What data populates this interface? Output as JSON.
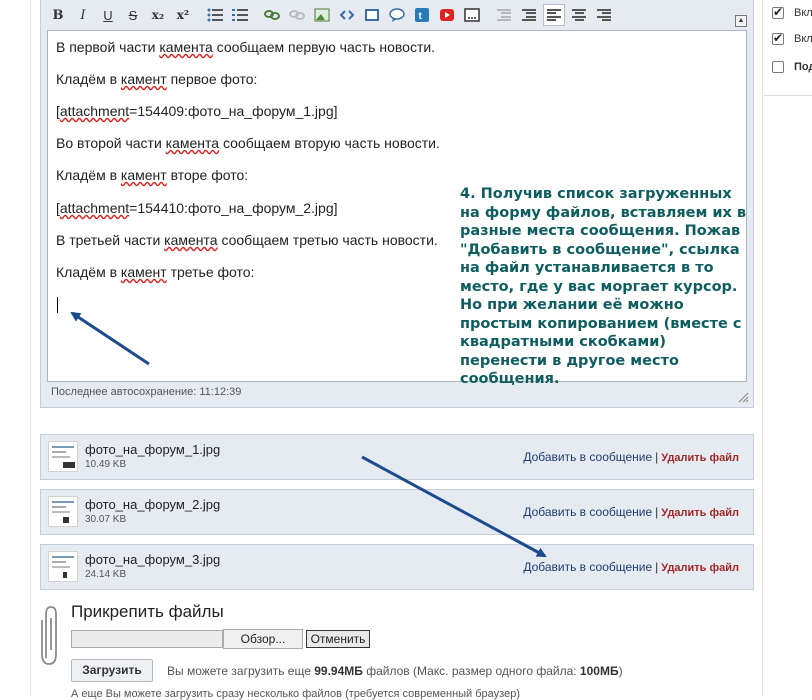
{
  "right_panel": {
    "items": [
      {
        "label": "Вкл",
        "checked": true
      },
      {
        "label": "Вкл",
        "checked": true
      },
      {
        "label": "Под",
        "checked": false
      }
    ]
  },
  "toolbar": {
    "buttons": [
      {
        "name": "bold-button",
        "glyph": "B"
      },
      {
        "name": "italic-button",
        "glyph": "I"
      },
      {
        "name": "underline-button",
        "glyph": "U"
      },
      {
        "name": "strikethrough-button",
        "glyph": "S"
      },
      {
        "name": "subscript-button",
        "glyph": "x₂"
      },
      {
        "name": "superscript-button",
        "glyph": "x²"
      }
    ],
    "collapse_glyph": "▲"
  },
  "editor": {
    "lines": [
      [
        "В первой части ",
        "камента",
        " сообщаем первую часть новости."
      ],
      [
        "Кладём в ",
        "камент",
        " первое фото:"
      ],
      [
        "[",
        "attachment",
        "=154409:фото_на_форум_1.jpg]"
      ],
      [
        "Во второй части ",
        "камента",
        " сообщаем вторую часть новости."
      ],
      [
        "Кладём в ",
        "камент",
        " вторе фото:"
      ],
      [
        "[",
        "attachment",
        "=154410:фото_на_форум_2.jpg]"
      ],
      [
        "В третьей части ",
        "камента",
        " сообщаем третью часть новости."
      ],
      [
        "Кладём в ",
        "камент",
        " третье фото:"
      ]
    ],
    "autosave": "Последнее автосохранение: 11:12:39"
  },
  "annotation": "4. Получив список загруженных на форму файлов, вставляем их в разные места сообщения. Пожав \"Добавить в сообщение\", ссылка на файл устанавливается в то место, где у вас моргает курсор. Но при желании её можно простым копированием (вместе с квадратными скобками) перенести в другое место сообщения.",
  "attachments": [
    {
      "name": "фото_на_форум_1.jpg",
      "size": "10.49 KB"
    },
    {
      "name": "фото_на_форум_2.jpg",
      "size": "30.07 KB"
    },
    {
      "name": "фото_на_форум_3.jpg",
      "size": "24.14 KB"
    }
  ],
  "attachment_actions": {
    "add": "Добавить в сообщение",
    "separator": "|",
    "delete": "Удалить файл"
  },
  "upload": {
    "title": "Прикрепить файлы",
    "browse": "Обзор...",
    "cancel": "Отменить",
    "submit": "Загрузить",
    "info_prefix": "Вы можете загрузить еще ",
    "remaining": "99.94МБ",
    "info_middle": " файлов (Макс. размер одного файла: ",
    "max_size": "100МБ",
    "info_suffix": ")",
    "cut_note": "А еще Вы можете загрузить сразу несколько файлов (требуется современный браузер)"
  },
  "colors": {
    "annotation": "#0e5e60",
    "arrow": "#1e4b8c",
    "delete_link": "#a02828",
    "add_link": "#1f3d6b"
  }
}
